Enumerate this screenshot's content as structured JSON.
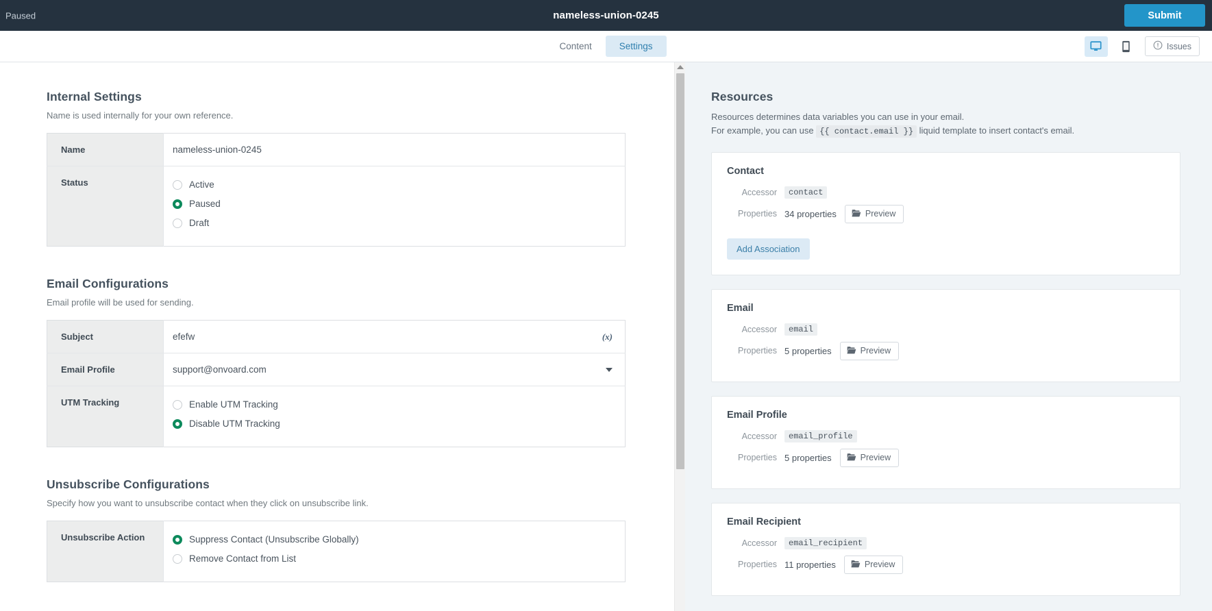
{
  "topbar": {
    "status": "Paused",
    "title": "nameless-union-0245",
    "submit_label": "Submit"
  },
  "tabbar": {
    "tabs": [
      {
        "label": "Content",
        "active": false
      },
      {
        "label": "Settings",
        "active": true
      }
    ],
    "desktop_icon": "desktop-icon",
    "mobile_icon": "mobile-icon",
    "issues_label": "Issues",
    "issues_icon": "exclamation-circle-icon",
    "highlight_color": "#f02d11"
  },
  "internal_settings": {
    "title": "Internal Settings",
    "subtitle": "Name is used internally for your own reference.",
    "name_label": "Name",
    "name_value": "nameless-union-0245",
    "status_label": "Status",
    "status_options": [
      {
        "label": "Active",
        "checked": false
      },
      {
        "label": "Paused",
        "checked": true
      },
      {
        "label": "Draft",
        "checked": false
      }
    ]
  },
  "email_configurations": {
    "title": "Email Configurations",
    "subtitle": "Email profile will be used for sending.",
    "subject_label": "Subject",
    "subject_value": "efefw",
    "subject_variable_icon": "(x)",
    "profile_label": "Email Profile",
    "profile_value": "support@onvoard.com",
    "utm_label": "UTM Tracking",
    "utm_options": [
      {
        "label": "Enable UTM Tracking",
        "checked": false
      },
      {
        "label": "Disable UTM Tracking",
        "checked": true
      }
    ]
  },
  "unsubscribe_configurations": {
    "title": "Unsubscribe Configurations",
    "subtitle": "Specify how you want to unsubscribe contact when they click on unsubscribe link.",
    "action_label": "Unsubscribe Action",
    "action_options": [
      {
        "label": "Suppress Contact (Unsubscribe Globally)",
        "checked": true
      },
      {
        "label": "Remove Contact from List",
        "checked": false
      }
    ]
  },
  "resources": {
    "title": "Resources",
    "subtitle_line1": "Resources determines data variables you can use in your email.",
    "subtitle_line2_pre": "For example, you can use",
    "subtitle_code": "{{ contact.email }}",
    "subtitle_line2_post": "liquid template to insert contact's email.",
    "accessor_label": "Accessor",
    "properties_label": "Properties",
    "preview_label": "Preview",
    "preview_icon": "folder-open-icon",
    "add_association_label": "Add Association",
    "cards": [
      {
        "title": "Contact",
        "accessor": "contact",
        "properties": "34 properties",
        "has_add_association": true
      },
      {
        "title": "Email",
        "accessor": "email",
        "properties": "5 properties",
        "has_add_association": false
      },
      {
        "title": "Email Profile",
        "accessor": "email_profile",
        "properties": "5 properties",
        "has_add_association": false
      },
      {
        "title": "Email Recipient",
        "accessor": "email_recipient",
        "properties": "11 properties",
        "has_add_association": false
      }
    ]
  },
  "colors": {
    "header_bg": "#25323f",
    "accent_blue": "#2395c9",
    "radio_green": "#0d8a5c",
    "panel_bg": "#f0f4f7",
    "highlight_red": "#f02d11"
  }
}
